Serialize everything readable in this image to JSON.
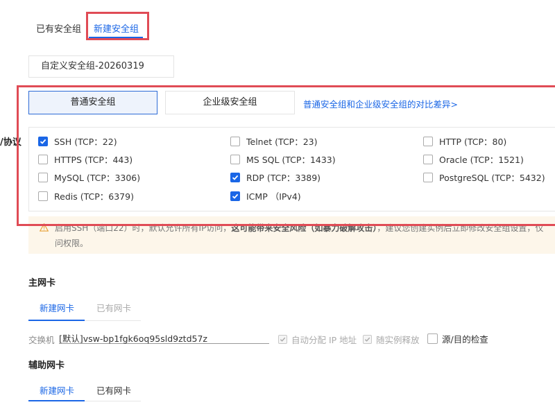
{
  "top_tabs": [
    {
      "label": "已有安全组",
      "active": false
    },
    {
      "label": "新建安全组",
      "active": true
    }
  ],
  "group_name": {
    "value": "自定义安全组-20260319"
  },
  "group_type": {
    "options": [
      "普通安全组",
      "企业级安全组"
    ],
    "selected": "普通安全组",
    "compare_link": "普通安全组和企业级安全组的对比差异>"
  },
  "side_label": "/协议",
  "ports": [
    {
      "label": "SSH (TCP：22)",
      "checked": true
    },
    {
      "label": "Telnet (TCP：23)",
      "checked": false
    },
    {
      "label": "HTTP (TCP：80)",
      "checked": false
    },
    {
      "label": "HTTPS (TCP：443)",
      "checked": false
    },
    {
      "label": "MS SQL (TCP：1433)",
      "checked": false
    },
    {
      "label": "Oracle (TCP：1521)",
      "checked": false
    },
    {
      "label": "MySQL (TCP：3306)",
      "checked": false
    },
    {
      "label": "RDP (TCP：3389)",
      "checked": true
    },
    {
      "label": "PostgreSQL (TCP：5432)",
      "checked": false
    },
    {
      "label": "Redis (TCP：6379)",
      "checked": false
    },
    {
      "label": "ICMP （IPv4)",
      "checked": true
    }
  ],
  "warning": {
    "line1_part1": "启用SSH（端口22）时，默认允许所有IP访问，",
    "line1_bold": "这可能带来安全风险（如暴力破解攻击）",
    "line1_part2": "，建议您创建实例后立即修改安全组设置，仅",
    "line2": "问权限。"
  },
  "primary_nic": {
    "title": "主网卡",
    "tabs": [
      "新建网卡",
      "已有网卡"
    ],
    "switch_label": "交换机",
    "switch_value": "[默认]vsw-bp1fgk6oq95sld9ztd57z",
    "auto_ip_label": "自动分配 IP 地址",
    "release_label": "随实例释放",
    "src_dst_label": "源/目的检查"
  },
  "secondary_nic": {
    "title": "辅助网卡",
    "tabs": [
      "新建网卡",
      "已有网卡"
    ]
  },
  "colors": {
    "accent": "#1a66e6",
    "highlight": "#e04b55",
    "warning_bg": "#fdf6ea"
  }
}
